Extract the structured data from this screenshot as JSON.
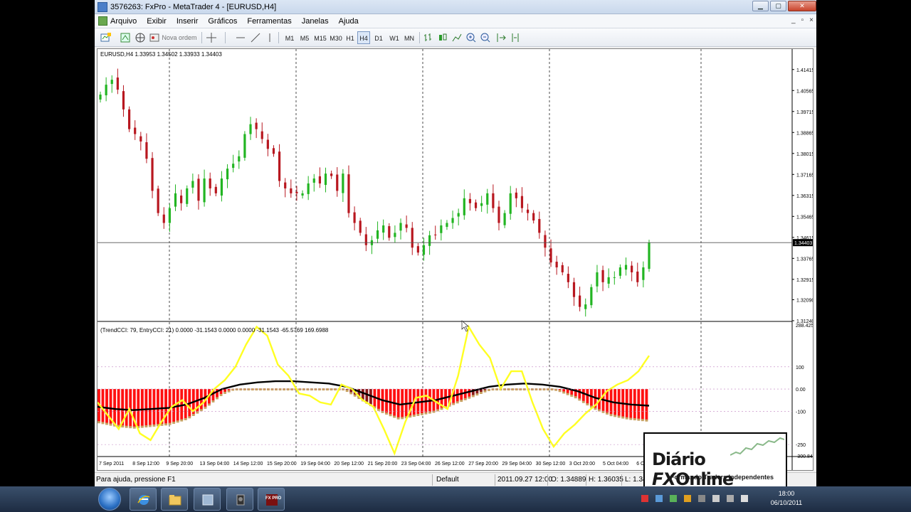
{
  "window": {
    "title": "3576263: FxPro - MetaTrader 4 - [EURUSD,H4]",
    "buttons": [
      "minimize",
      "maximize",
      "close"
    ]
  },
  "menu": {
    "items": [
      "Arquivo",
      "Exibir",
      "Inserir",
      "Gráficos",
      "Ferramentas",
      "Janelas",
      "Ajuda"
    ],
    "mdi_buttons": [
      "_",
      "▫",
      "×"
    ]
  },
  "toolbar": {
    "new_order_label": "Nova ordem",
    "timeframes": [
      "M1",
      "M5",
      "M15",
      "M30",
      "H1",
      "H4",
      "D1",
      "W1",
      "MN"
    ],
    "active_timeframe": "H4"
  },
  "chart": {
    "header": "EURUSD,H4  1.33953 1.34502 1.33933 1.34403",
    "price_levels": [
      "1.41415",
      "1.40565",
      "1.39715",
      "1.38865",
      "1.38015",
      "1.37165",
      "1.36315",
      "1.35465",
      "1.34615",
      "1.33765",
      "1.32915",
      "1.32090",
      "1.31240"
    ],
    "current_price": "1.34403",
    "indicator_header": "(TrendCCI: 79, EntryCCI: 21)  0.0000 -31.1543 0.0000 0.0000 -31.1543 -65.5769 169.6988",
    "indicator_levels": [
      "288.4255",
      "100",
      "0.00",
      "-100",
      "-250",
      "-300.842"
    ],
    "date_labels": [
      "7 Sep 2011",
      "8 Sep 12:00",
      "9 Sep 20:00",
      "13 Sep 04:00",
      "14 Sep 12:00",
      "15 Sep 20:00",
      "19 Sep 04:00",
      "20 Sep 12:00",
      "21 Sep 20:00",
      "23 Sep 04:00",
      "26 Sep 12:00",
      "27 Sep 20:00",
      "29 Sep 04:00",
      "30 Sep 12:00",
      "3 Oct 20:00",
      "5 Oct 04:00",
      "6 O"
    ],
    "colors": {
      "bull": "#22b522",
      "bear": "#b8171f",
      "yellow": "#ffff22",
      "histogram": "#ff1010",
      "black_line": "#000000"
    }
  },
  "chart_data": {
    "type": "candlestick",
    "symbol": "EURUSD",
    "timeframe": "H4",
    "ylim": [
      1.3124,
      1.4184
    ],
    "closes": [
      1.404,
      1.408,
      1.41,
      1.406,
      1.398,
      1.39,
      1.388,
      1.385,
      1.378,
      1.365,
      1.356,
      1.352,
      1.358,
      1.364,
      1.36,
      1.366,
      1.369,
      1.361,
      1.37,
      1.366,
      1.364,
      1.37,
      1.374,
      1.376,
      1.379,
      1.388,
      1.392,
      1.39,
      1.386,
      1.382,
      1.38,
      1.369,
      1.366,
      1.364,
      1.364,
      1.364,
      1.368,
      1.37,
      1.368,
      1.372,
      1.371,
      1.365,
      1.372,
      1.356,
      1.352,
      1.348,
      1.343,
      1.345,
      1.349,
      1.351,
      1.346,
      1.348,
      1.352,
      1.35,
      1.342,
      1.34,
      1.343,
      1.347,
      1.347,
      1.351,
      1.352,
      1.354,
      1.356,
      1.362,
      1.36,
      1.358,
      1.36,
      1.364,
      1.358,
      1.352,
      1.356,
      1.364,
      1.362,
      1.358,
      1.356,
      1.353,
      1.348,
      1.342,
      1.336,
      1.334,
      1.332,
      1.328,
      1.322,
      1.318,
      1.319,
      1.326,
      1.332,
      1.328,
      1.33,
      1.33,
      1.334,
      1.335,
      1.332,
      1.328,
      1.334,
      1.344
    ],
    "cci_yellow": [
      -60,
      -120,
      -180,
      -90,
      -200,
      -230,
      -150,
      -80,
      -50,
      -100,
      -60,
      0,
      40,
      100,
      200,
      280,
      240,
      110,
      60,
      -20,
      -30,
      -60,
      -70,
      20,
      0,
      -50,
      -80,
      -180,
      -290,
      -150,
      -40,
      -30,
      -60,
      -90,
      60,
      280,
      200,
      140,
      0,
      80,
      80,
      -60,
      -180,
      -260,
      -200,
      -160,
      -110,
      -70,
      -10,
      20,
      40,
      80,
      150
    ],
    "cci_black": [
      -80,
      -90,
      -95,
      -90,
      -85,
      -70,
      -40,
      0,
      20,
      30,
      35,
      35,
      30,
      25,
      10,
      -20,
      -50,
      -70,
      -60,
      -50,
      -30,
      -10,
      10,
      20,
      25,
      20,
      10,
      -10,
      -40,
      -60,
      -70,
      -75
    ]
  },
  "status": {
    "help": "Para ajuda, pressione F1",
    "profile": "Default",
    "time": "2011.09.27 12:00",
    "open": "O: 1.34889",
    "high": "H: 1.36035",
    "low": "L: 1.34"
  },
  "logo": {
    "name_part1": "Diário ",
    "name_part2": "FX",
    "name_part3": "Online",
    "tagline": "Formando Traders Independentes"
  },
  "taskbar": {
    "clock_time": "18:00",
    "clock_date": "06/10/2011",
    "task_labels": [
      "FX PRO"
    ]
  }
}
